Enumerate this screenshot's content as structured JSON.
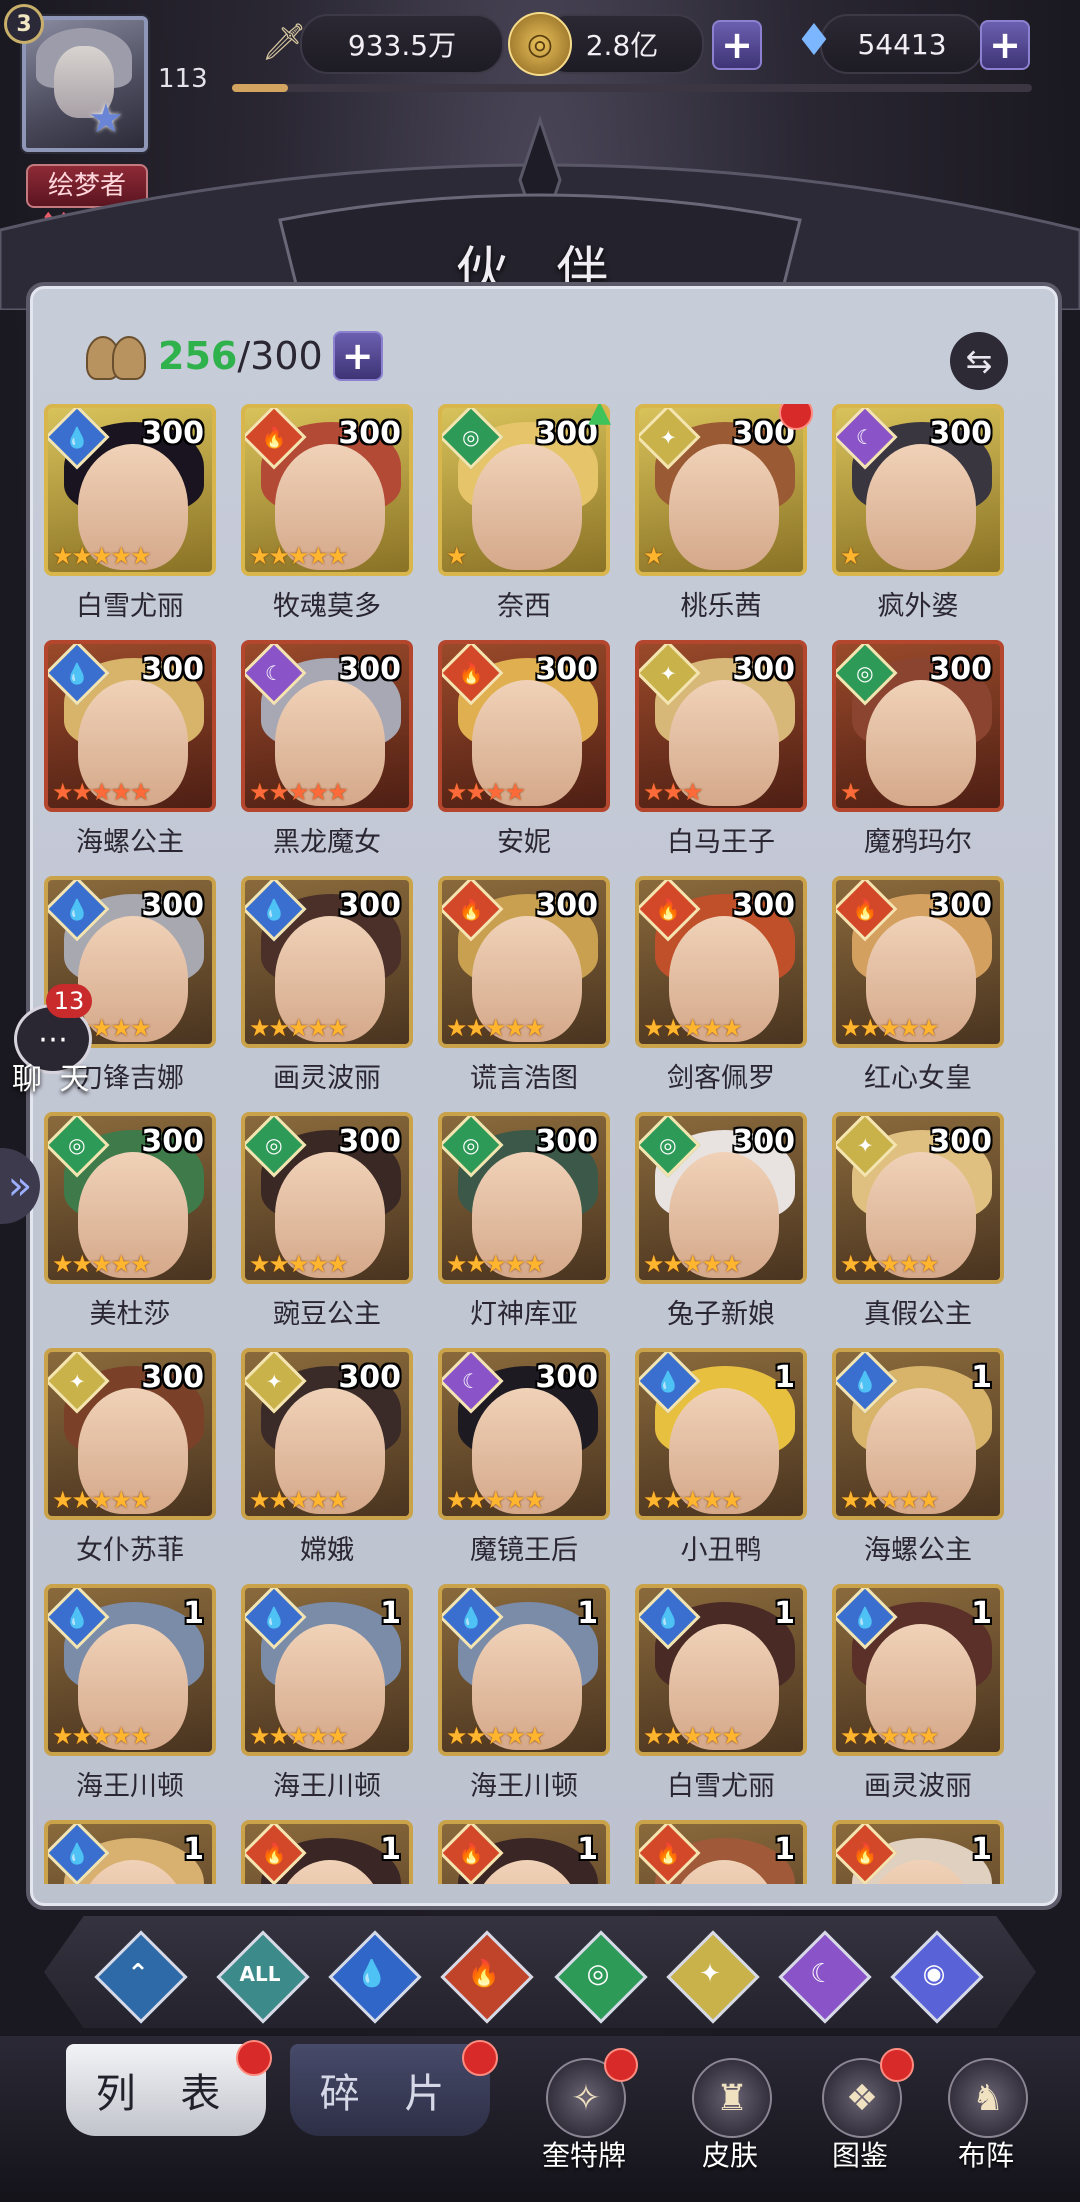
{
  "player": {
    "avatar_level": "3",
    "level": "113",
    "title": "绘梦者",
    "exp_progress": 0.07
  },
  "resources": {
    "power": "933.5万",
    "gold": "2.8亿",
    "diamonds": "54413"
  },
  "header": {
    "title": "伙 伴"
  },
  "roster": {
    "current": "256",
    "max": "300"
  },
  "chat": {
    "label": "聊 天",
    "unread": "13"
  },
  "heroes": [
    {
      "name": "白雪尤丽",
      "level": "300",
      "element": "water",
      "stars": 5,
      "star_color": "gold",
      "frame": "gold",
      "hair": "#1a1420"
    },
    {
      "name": "牧魂莫多",
      "level": "300",
      "element": "fire",
      "stars": 5,
      "star_color": "gold",
      "frame": "gold",
      "hair": "#b24a36"
    },
    {
      "name": "奈西",
      "level": "300",
      "element": "wind",
      "stars": 1,
      "star_color": "gold",
      "frame": "gold",
      "hair": "#e6c46a",
      "upgrade": true
    },
    {
      "name": "桃乐茜",
      "level": "300",
      "element": "light",
      "stars": 1,
      "star_color": "gold",
      "frame": "gold",
      "hair": "#9a5a34",
      "alert": true
    },
    {
      "name": "疯外婆",
      "level": "300",
      "element": "dark",
      "stars": 1,
      "star_color": "gold",
      "frame": "gold",
      "hair": "#3a3640"
    },
    {
      "name": "海螺公主",
      "level": "300",
      "element": "water",
      "stars": 5,
      "star_color": "red",
      "frame": "red",
      "hair": "#d7b46a"
    },
    {
      "name": "黑龙魔女",
      "level": "300",
      "element": "dark",
      "stars": 5,
      "star_color": "red",
      "frame": "red",
      "hair": "#a8a8b4"
    },
    {
      "name": "安妮",
      "level": "300",
      "element": "fire",
      "stars": 4,
      "star_color": "red",
      "frame": "red",
      "hair": "#e0b050"
    },
    {
      "name": "白马王子",
      "level": "300",
      "element": "light",
      "stars": 3,
      "star_color": "red",
      "frame": "red",
      "hair": "#d8b878"
    },
    {
      "name": "魔鸦玛尔",
      "level": "300",
      "element": "wind",
      "stars": 1,
      "star_color": "red",
      "frame": "red",
      "hair": "#8a4430"
    },
    {
      "name": "刀锋吉娜",
      "level": "300",
      "element": "water",
      "stars": 5,
      "star_color": "gold",
      "frame": "brown",
      "hair": "#a8a8b0"
    },
    {
      "name": "画灵波丽",
      "level": "300",
      "element": "water",
      "stars": 5,
      "star_color": "gold",
      "frame": "brown",
      "hair": "#4a3028"
    },
    {
      "name": "谎言浩图",
      "level": "300",
      "element": "fire",
      "stars": 5,
      "star_color": "gold",
      "frame": "brown",
      "hair": "#c8a050"
    },
    {
      "name": "剑客佩罗",
      "level": "300",
      "element": "fire",
      "stars": 5,
      "star_color": "gold",
      "frame": "brown",
      "hair": "#c0502a"
    },
    {
      "name": "红心女皇",
      "level": "300",
      "element": "fire",
      "stars": 5,
      "star_color": "gold",
      "frame": "brown",
      "hair": "#d4a060"
    },
    {
      "name": "美杜莎",
      "level": "300",
      "element": "wind",
      "stars": 5,
      "star_color": "gold",
      "frame": "brown",
      "hair": "#3e7a4a"
    },
    {
      "name": "豌豆公主",
      "level": "300",
      "element": "wind",
      "stars": 5,
      "star_color": "gold",
      "frame": "brown",
      "hair": "#3a2824"
    },
    {
      "name": "灯神库亚",
      "level": "300",
      "element": "wind",
      "stars": 5,
      "star_color": "gold",
      "frame": "brown",
      "hair": "#3c5848"
    },
    {
      "name": "兔子新娘",
      "level": "300",
      "element": "wind",
      "stars": 5,
      "star_color": "gold",
      "frame": "brown",
      "hair": "#e8e2e0"
    },
    {
      "name": "真假公主",
      "level": "300",
      "element": "light",
      "stars": 5,
      "star_color": "gold",
      "frame": "brown",
      "hair": "#e0c080"
    },
    {
      "name": "女仆苏菲",
      "level": "300",
      "element": "light",
      "stars": 5,
      "star_color": "gold",
      "frame": "brown",
      "hair": "#7a4028"
    },
    {
      "name": "嫦娥",
      "level": "300",
      "element": "light",
      "stars": 5,
      "star_color": "gold",
      "frame": "brown",
      "hair": "#3a2a28"
    },
    {
      "name": "魔镜王后",
      "level": "300",
      "element": "dark",
      "stars": 5,
      "star_color": "gold",
      "frame": "brown",
      "hair": "#1e1a22"
    },
    {
      "name": "小丑鸭",
      "level": "1",
      "element": "water",
      "stars": 5,
      "star_color": "gold",
      "frame": "brown",
      "hair": "#e8c040"
    },
    {
      "name": "海螺公主",
      "level": "1",
      "element": "water",
      "stars": 5,
      "star_color": "gold",
      "frame": "brown",
      "hair": "#d7b46a"
    },
    {
      "name": "海王川顿",
      "level": "1",
      "element": "water",
      "stars": 5,
      "star_color": "gold",
      "frame": "brown",
      "hair": "#7a8ca8"
    },
    {
      "name": "海王川顿",
      "level": "1",
      "element": "water",
      "stars": 5,
      "star_color": "gold",
      "frame": "brown",
      "hair": "#7a8ca8"
    },
    {
      "name": "海王川顿",
      "level": "1",
      "element": "water",
      "stars": 5,
      "star_color": "gold",
      "frame": "brown",
      "hair": "#7a8ca8"
    },
    {
      "name": "白雪尤丽",
      "level": "1",
      "element": "water",
      "stars": 5,
      "star_color": "gold",
      "frame": "brown",
      "hair": "#4a2a24"
    },
    {
      "name": "画灵波丽",
      "level": "1",
      "element": "water",
      "stars": 5,
      "star_color": "gold",
      "frame": "brown",
      "hair": "#5a3028"
    },
    {
      "name": "",
      "level": "1",
      "element": "water",
      "stars": 0,
      "star_color": "gold",
      "frame": "brown",
      "hair": "#d8b070"
    },
    {
      "name": "",
      "level": "1",
      "element": "fire",
      "stars": 0,
      "star_color": "gold",
      "frame": "brown",
      "hair": "#3a2624"
    },
    {
      "name": "",
      "level": "1",
      "element": "fire",
      "stars": 0,
      "star_color": "gold",
      "frame": "brown",
      "hair": "#3a2624"
    },
    {
      "name": "",
      "level": "1",
      "element": "fire",
      "stars": 0,
      "star_color": "gold",
      "frame": "brown",
      "hair": "#a05a3a"
    },
    {
      "name": "",
      "level": "1",
      "element": "fire",
      "stars": 0,
      "star_color": "gold",
      "frame": "brown",
      "hair": "#e0d0c0"
    }
  ],
  "elements": {
    "water": {
      "color": "#3a6fd0",
      "glyph": "💧"
    },
    "fire": {
      "color": "#d4482a",
      "glyph": "🔥"
    },
    "wind": {
      "color": "#2e9a58",
      "glyph": "◎"
    },
    "light": {
      "color": "#c9b24a",
      "glyph": "✦"
    },
    "dark": {
      "color": "#8a54c8",
      "glyph": "☾"
    }
  },
  "filters": [
    {
      "name": "filter-class",
      "glyph": "⌃",
      "color": "#2e6aa8"
    },
    {
      "name": "filter-all",
      "glyph": "ALL",
      "color": "#3c8a8a"
    },
    {
      "name": "filter-water",
      "glyph": "💧",
      "color": "#2f66c8"
    },
    {
      "name": "filter-fire",
      "glyph": "🔥",
      "color": "#c0442a"
    },
    {
      "name": "filter-wind",
      "glyph": "◎",
      "color": "#2e9a58"
    },
    {
      "name": "filter-light",
      "glyph": "✦",
      "color": "#c9b24a"
    },
    {
      "name": "filter-dark",
      "glyph": "☾",
      "color": "#8a54c8"
    },
    {
      "name": "filter-cosmic",
      "glyph": "◉",
      "color": "#5a62d8"
    }
  ],
  "tabs": {
    "list": "列 表",
    "fragments": "碎 片"
  },
  "nav": [
    {
      "label": "奎特牌",
      "icon": "card-emblem-icon",
      "alert": true
    },
    {
      "label": "皮肤",
      "icon": "outfit-icon",
      "alert": false
    },
    {
      "label": "图鉴",
      "icon": "portrait-book-icon",
      "alert": true
    },
    {
      "label": "布阵",
      "icon": "formation-icon",
      "alert": false
    }
  ]
}
